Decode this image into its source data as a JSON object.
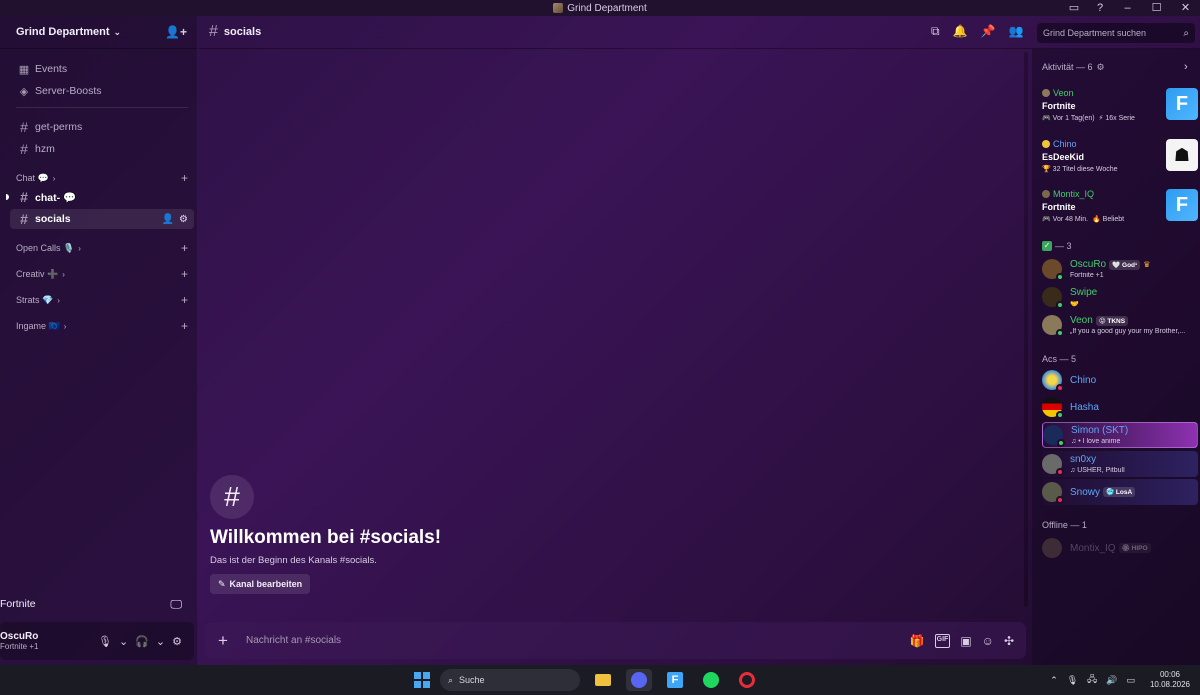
{
  "window": {
    "title": "Grind Department"
  },
  "server": {
    "name": "Grind Department"
  },
  "sidebar": {
    "top_items": [
      {
        "label": "Events",
        "icon": "calendar-icon"
      },
      {
        "label": "Server-Boosts",
        "icon": "boost-icon"
      }
    ],
    "channels": [
      "get-perms",
      "hzm"
    ],
    "categories": {
      "chat": "Chat 💬",
      "open_calls": "Open Calls 🎙️",
      "creativ": "Creativ ➕",
      "strats": "Strats 💎",
      "ingame": "Ingame 🇪🇺"
    },
    "chat_channels": [
      {
        "name": "chat- 💬"
      },
      {
        "name": "socials"
      }
    ]
  },
  "activity_panel": {
    "game": "Fortnite"
  },
  "user_panel": {
    "name": "OscuRo",
    "status": "Fortnite +1"
  },
  "channel": {
    "name": "socials",
    "search_placeholder": "Grind Department suchen"
  },
  "welcome": {
    "title": "Willkommen bei #socials!",
    "subtitle": "Das ist der Beginn des Kanals #socials.",
    "edit_button": "Kanal bearbeiten"
  },
  "composer": {
    "placeholder": "Nachricht an #socials"
  },
  "members": {
    "activity_title": "Aktivität — 6",
    "activities": [
      {
        "user": "Veon",
        "game": "Fortnite",
        "meta1": "Vor 1 Tag(en)",
        "meta2": "16x Serie",
        "thumb": "F"
      },
      {
        "user": "Chino",
        "game": "EsDeeKid",
        "meta1": "32 Titel diese Woche",
        "meta2": "",
        "thumb": ""
      },
      {
        "user": "Montix_IQ",
        "game": "Fortnite",
        "meta1": "Vor 48 Min.",
        "meta2": "Beliebt",
        "thumb": "F"
      }
    ],
    "group1_title": "— 3",
    "group1": [
      {
        "name": "OscuRo",
        "badge": "🤍 God¹",
        "sub": "Fortnite +1",
        "color": "#3fcf6a"
      },
      {
        "name": "Swipe",
        "badge": "",
        "sub": "🤝",
        "color": "#3fcf6a"
      },
      {
        "name": "Veon",
        "badge": "😝 TKNS",
        "sub": "„If you a good guy your my Brother,...",
        "color": "#3fcf6a"
      }
    ],
    "group2_title": "Acs — 5",
    "group2": [
      {
        "name": "Chino",
        "badge": "",
        "sub": "",
        "color": "#5fa8f5"
      },
      {
        "name": "Hasha",
        "badge": "",
        "sub": "",
        "color": "#5fa8f5"
      },
      {
        "name": "Simon (SKT)",
        "badge": "",
        "sub": "♫ • I love anime",
        "color": "#5fa8f5"
      },
      {
        "name": "sn0xy",
        "badge": "",
        "sub": "♫ USHER, Pitbull",
        "color": "#5fa8f5"
      },
      {
        "name": "Snowy",
        "badge": "🥶 LosA",
        "sub": "",
        "color": "#5fa8f5"
      }
    ],
    "offline_title": "Offline — 1",
    "offline": [
      {
        "name": "Montix_IQ",
        "badge": "🏵 HIPO"
      }
    ]
  },
  "taskbar": {
    "search_label": "Suche",
    "time": "00:06",
    "date": "10.08.2026"
  },
  "colors": {
    "accent": "#5865f2",
    "online": "#3fcf6a",
    "dnd": "#e0324a",
    "role_green": "#3fcf6a",
    "role_blue": "#5fa8f5"
  }
}
